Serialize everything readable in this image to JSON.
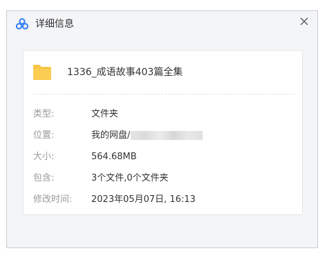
{
  "dialog": {
    "title": "详细信息",
    "icon": "baidu-netdisk-logo",
    "close_icon": "close-icon",
    "close_glyph": "✕"
  },
  "file": {
    "icon": "folder-icon",
    "name": "1336_成语故事403篇全集"
  },
  "properties": [
    {
      "label": "类型:",
      "value": "文件夹"
    },
    {
      "label": "位置:",
      "value": "我的网盘/"
    },
    {
      "label": "大小:",
      "value": "564.68MB"
    },
    {
      "label": "包含:",
      "value": "3个文件,0个文件夹"
    },
    {
      "label": "修改时间:",
      "value": "2023年05月07日, 16:13"
    }
  ],
  "colors": {
    "folder": "#f9c443",
    "brand_blue": "#2f7df6",
    "label": "#999999",
    "text": "#333333"
  }
}
